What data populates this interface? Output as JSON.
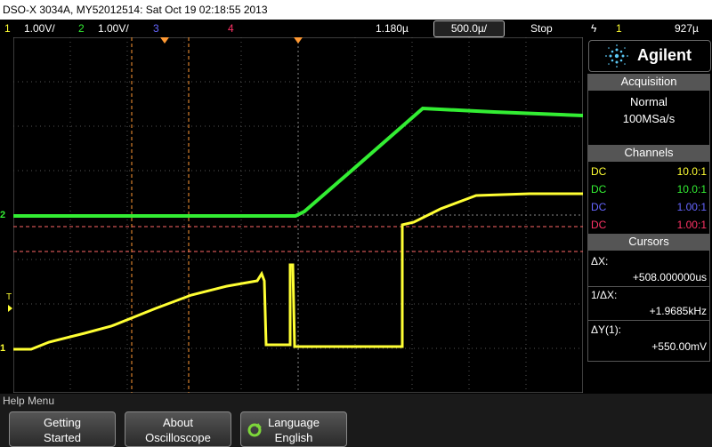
{
  "title": "DSO-X 3034A, MY52012514: Sat Oct 19 02:18:55 2013",
  "status": {
    "ch1": {
      "num": "1",
      "scale": "1.00V/"
    },
    "ch2": {
      "num": "2",
      "scale": "1.00V/"
    },
    "ch3": {
      "num": "3"
    },
    "ch4": {
      "num": "4"
    },
    "delay": "1.180µ",
    "timebase": "500.0µ/",
    "run_state": "Stop",
    "trigger_icon": "ϟ",
    "trigger_channel": "1",
    "trigger_level": "927µ"
  },
  "brand": {
    "logo_text": "Agilent"
  },
  "acquisition": {
    "title": "Acquisition",
    "mode": "Normal",
    "rate": "100MSa/s"
  },
  "channels": {
    "title": "Channels",
    "rows": [
      {
        "coupling": "DC",
        "probe": "10.0:1",
        "color": "#ffff33"
      },
      {
        "coupling": "DC",
        "probe": "10.0:1",
        "color": "#33ee33"
      },
      {
        "coupling": "DC",
        "probe": "1.00:1",
        "color": "#6666ff"
      },
      {
        "coupling": "DC",
        "probe": "1.00:1",
        "color": "#ff3366"
      }
    ]
  },
  "cursors": {
    "title": "Cursors",
    "dx_label": "ΔX:",
    "dx_value": "+508.000000us",
    "inv_dx_label": "1/ΔX:",
    "inv_dx_value": "+1.9685kHz",
    "dy_label": "ΔY(1):",
    "dy_value": "+550.00mV"
  },
  "help_menu": {
    "label": "Help Menu",
    "softkeys": [
      {
        "line1": "Getting",
        "line2": "Started"
      },
      {
        "line1": "About",
        "line2": "Oscilloscope"
      },
      {
        "line1": "Language",
        "line2": "English"
      }
    ]
  },
  "markers": {
    "ch2_ground": "2",
    "ch1_ground": "1",
    "trigger_level": "T"
  },
  "colors": {
    "ch1": "#ffff33",
    "ch2": "#33ee33",
    "ch3": "#6666ff",
    "ch4": "#ff3366",
    "cursor": "#ff9933"
  }
}
